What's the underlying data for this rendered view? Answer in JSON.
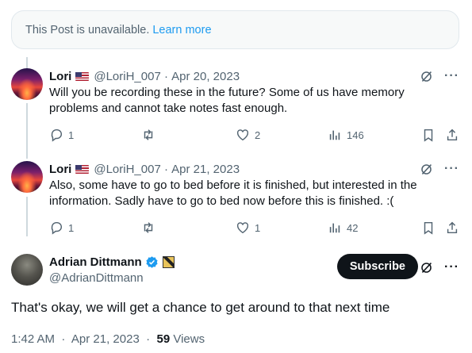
{
  "unavailable": {
    "message": "This Post is unavailable.",
    "link": "Learn more"
  },
  "replies": [
    {
      "name": "Lori",
      "handle": "@LoriH_007",
      "date": "Apr 20, 2023",
      "text_lines": [
        "Will you be recording these in the future?  Some of us have memory",
        "problems and cannot take notes fast enough."
      ],
      "stats": {
        "replies": "1",
        "reposts": "",
        "likes": "2",
        "views": "146"
      }
    },
    {
      "name": "Lori",
      "handle": "@LoriH_007",
      "date": "Apr 21, 2023",
      "text_lines": [
        "Also, some have to go to bed before it is finished, but interested in the",
        "information.  Sadly have to go to bed now before this is finished.  :("
      ],
      "stats": {
        "replies": "1",
        "reposts": "",
        "likes": "1",
        "views": "42"
      }
    }
  ],
  "main": {
    "name": "Adrian Dittmann",
    "handle": "@AdrianDittmann",
    "subscribe_label": "Subscribe",
    "text": "That's okay, we will get a chance to get around to that next time",
    "time": "1:42 AM",
    "date": "Apr 21, 2023",
    "views_count": "59",
    "views_label": "Views"
  },
  "icons": [
    "grok-icon",
    "more-icon",
    "reply-icon",
    "repost-icon",
    "like-icon",
    "views-icon",
    "bookmark-icon",
    "share-icon",
    "verified-icon",
    "affiliate-badge-icon",
    "flag-us-icon"
  ],
  "colors": {
    "link": "#1d9bf0",
    "muted": "#536471",
    "text": "#0f1419",
    "verified": "#1d9bf0"
  }
}
